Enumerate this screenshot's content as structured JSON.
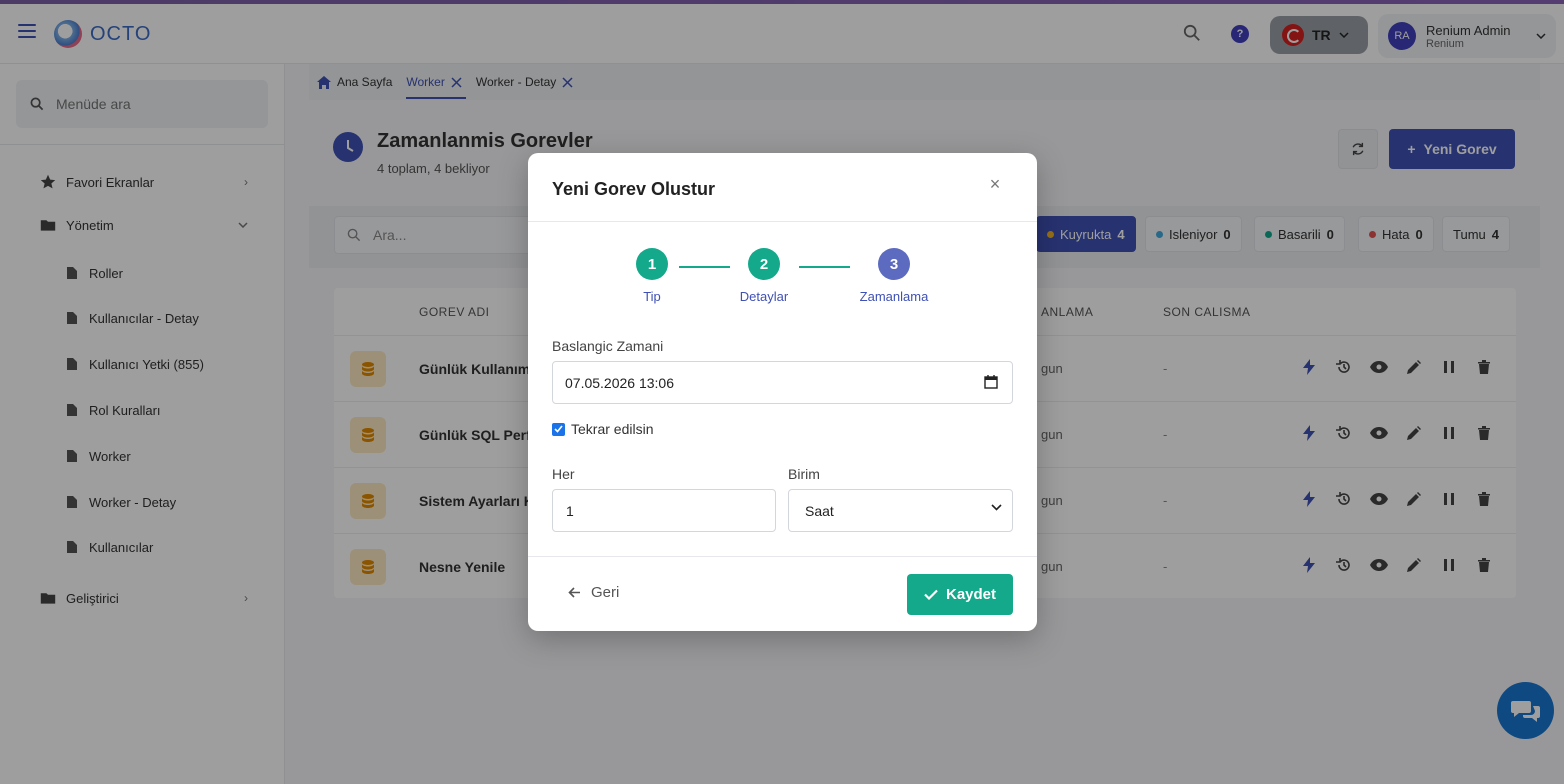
{
  "app": {
    "logo_text": "OCTO"
  },
  "header": {
    "lang_code": "TR",
    "user_initials": "RA",
    "user_name": "Renium Admin",
    "user_org": "Renium"
  },
  "sidebar": {
    "search_placeholder": "Menüde ara",
    "items": [
      {
        "label": "Favori Ekranlar"
      },
      {
        "label": "Yönetim"
      },
      {
        "label": "Geliştirici"
      }
    ],
    "sub_items": [
      {
        "label": "Roller"
      },
      {
        "label": "Kullanıcılar - Detay"
      },
      {
        "label": "Kullanıcı Yetki (855)"
      },
      {
        "label": "Rol Kuralları"
      },
      {
        "label": "Worker"
      },
      {
        "label": "Worker - Detay"
      },
      {
        "label": "Kullanıcılar"
      }
    ]
  },
  "tabs": [
    {
      "label": "Ana Sayfa"
    },
    {
      "label": "Worker"
    },
    {
      "label": "Worker - Detay"
    }
  ],
  "page": {
    "title": "Zamanlanmis Gorevler",
    "subtitle": "4 toplam, 4 bekliyor",
    "new_button": "Yeni Gorev",
    "search_placeholder": "Ara..."
  },
  "filters": [
    {
      "label": "Kuyrukta",
      "count": "4",
      "color": "#f0b429"
    },
    {
      "label": "Isleniyor",
      "count": "0",
      "color": "#3fa9e0"
    },
    {
      "label": "Basarili",
      "count": "0",
      "color": "#14a98b"
    },
    {
      "label": "Hata",
      "count": "0",
      "color": "#e05252"
    },
    {
      "label": "Tumu",
      "count": "4",
      "color": ""
    }
  ],
  "table": {
    "headers": {
      "name": "GOREV ADI",
      "schedule": "ANLAMA",
      "last_run": "SON CALISMA"
    },
    "rows": [
      {
        "name": "Günlük Kullanım",
        "schedule": "gun",
        "last_run": "-"
      },
      {
        "name": "Günlük SQL Perfo",
        "schedule": "gun",
        "last_run": "-"
      },
      {
        "name": "Sistem Ayarları K",
        "schedule": "gun",
        "last_run": "-"
      },
      {
        "name": "Nesne Yenile",
        "schedule": "gun",
        "last_run": "-"
      }
    ]
  },
  "modal": {
    "title": "Yeni Gorev Olustur",
    "steps": [
      {
        "number": "1",
        "label": "Tip"
      },
      {
        "number": "2",
        "label": "Detaylar"
      },
      {
        "number": "3",
        "label": "Zamanlama"
      }
    ],
    "start_label": "Baslangic Zamani",
    "start_value": "07.05.2026 13:06",
    "repeat_label": "Tekrar edilsin",
    "repeat_checked": true,
    "every_label": "Her",
    "every_value": "1",
    "unit_label": "Birim",
    "unit_value": "Saat",
    "back_label": "Geri",
    "save_label": "Kaydet"
  },
  "colors": {
    "primary": "#3f51b5",
    "success": "#14a98b",
    "step_current": "#5c6bc0"
  }
}
